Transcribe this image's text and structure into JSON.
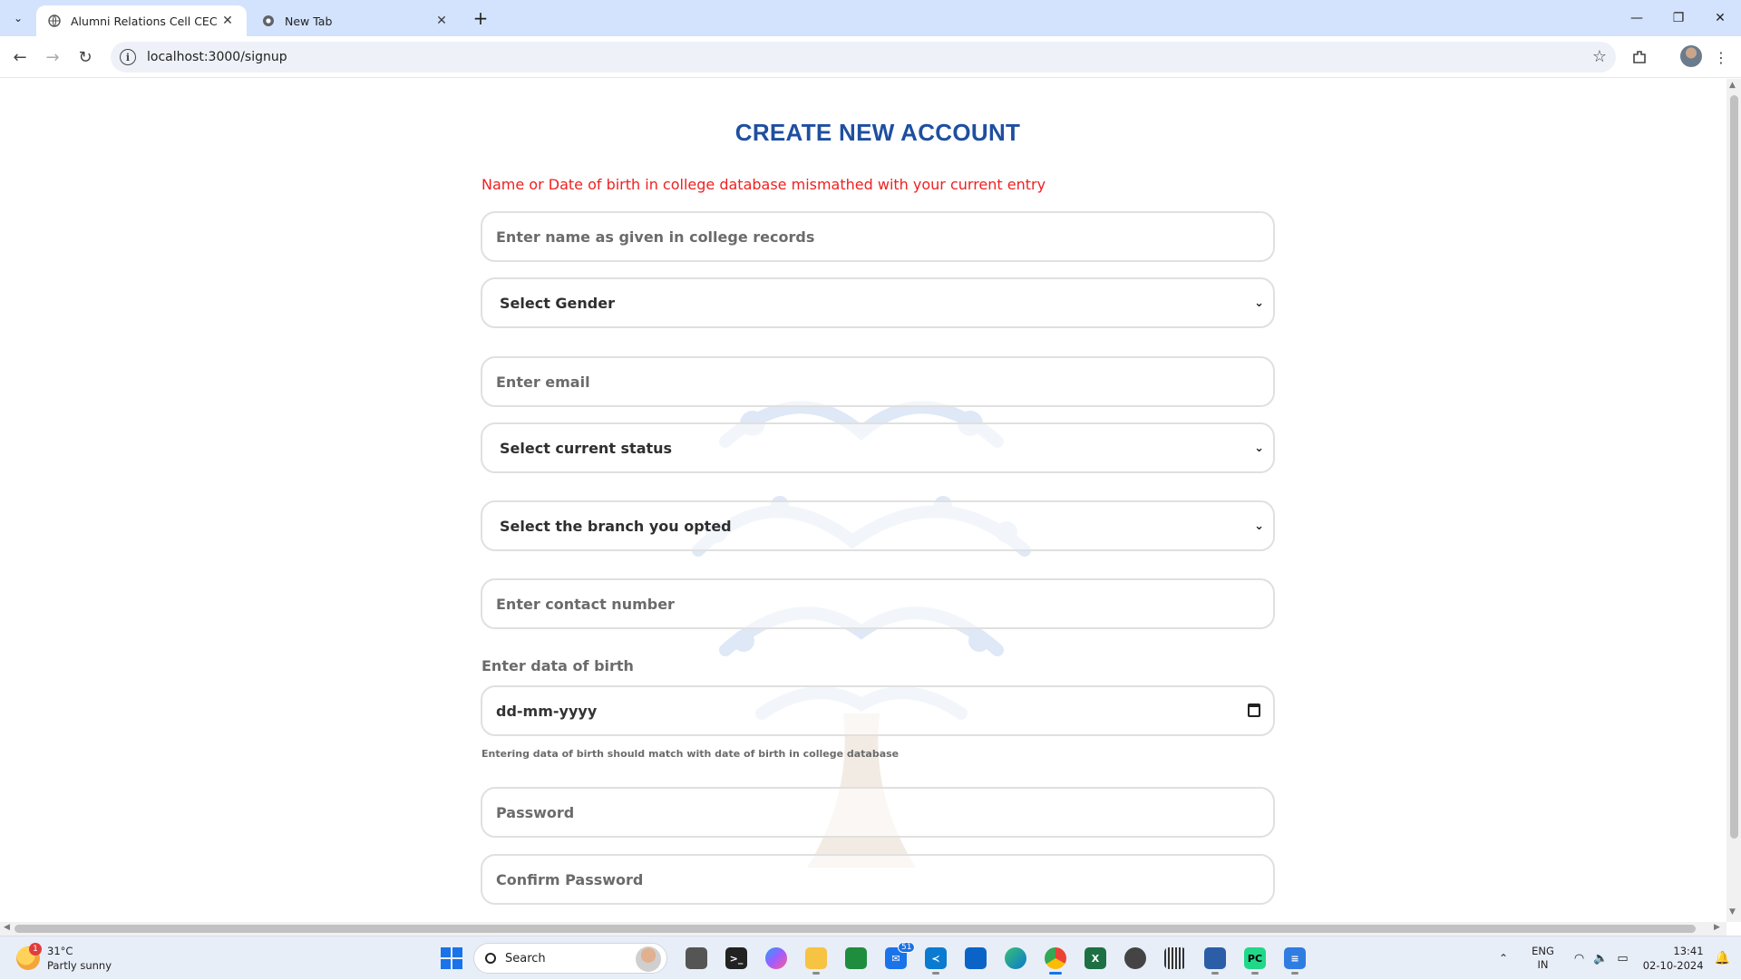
{
  "browser": {
    "tabs": [
      {
        "title": "Alumni Relations Cell CEC",
        "active": true
      },
      {
        "title": "New Tab",
        "active": false
      }
    ],
    "url": "localhost:3000/signup"
  },
  "page": {
    "heading": "CREATE NEW ACCOUNT",
    "error": "Name or Date of birth in college database mismathed with your current entry",
    "name_placeholder": "Enter name as given in college records",
    "gender_select": "Select Gender",
    "email_placeholder": "Enter email",
    "status_select": "Select current status",
    "branch_select": "Select the branch you opted",
    "contact_placeholder": "Enter contact number",
    "dob_label": "Enter data of birth",
    "dob_value": "dd-mm-yyyy",
    "dob_hint": "Entering data of birth should match with date of birth in college database",
    "password_placeholder": "Password",
    "confirm_placeholder": "Confirm Password"
  },
  "taskbar": {
    "weather_temp": "31°C",
    "weather_desc": "Partly sunny",
    "weather_badge": "1",
    "search": "Search",
    "lang_top": "ENG",
    "lang_bottom": "IN",
    "time": "13:41",
    "date": "02-10-2024",
    "mail_badge": "51",
    "colors": {
      "accent": "#1a73e8",
      "heading": "#1e4fa0",
      "error": "#f02020"
    }
  }
}
